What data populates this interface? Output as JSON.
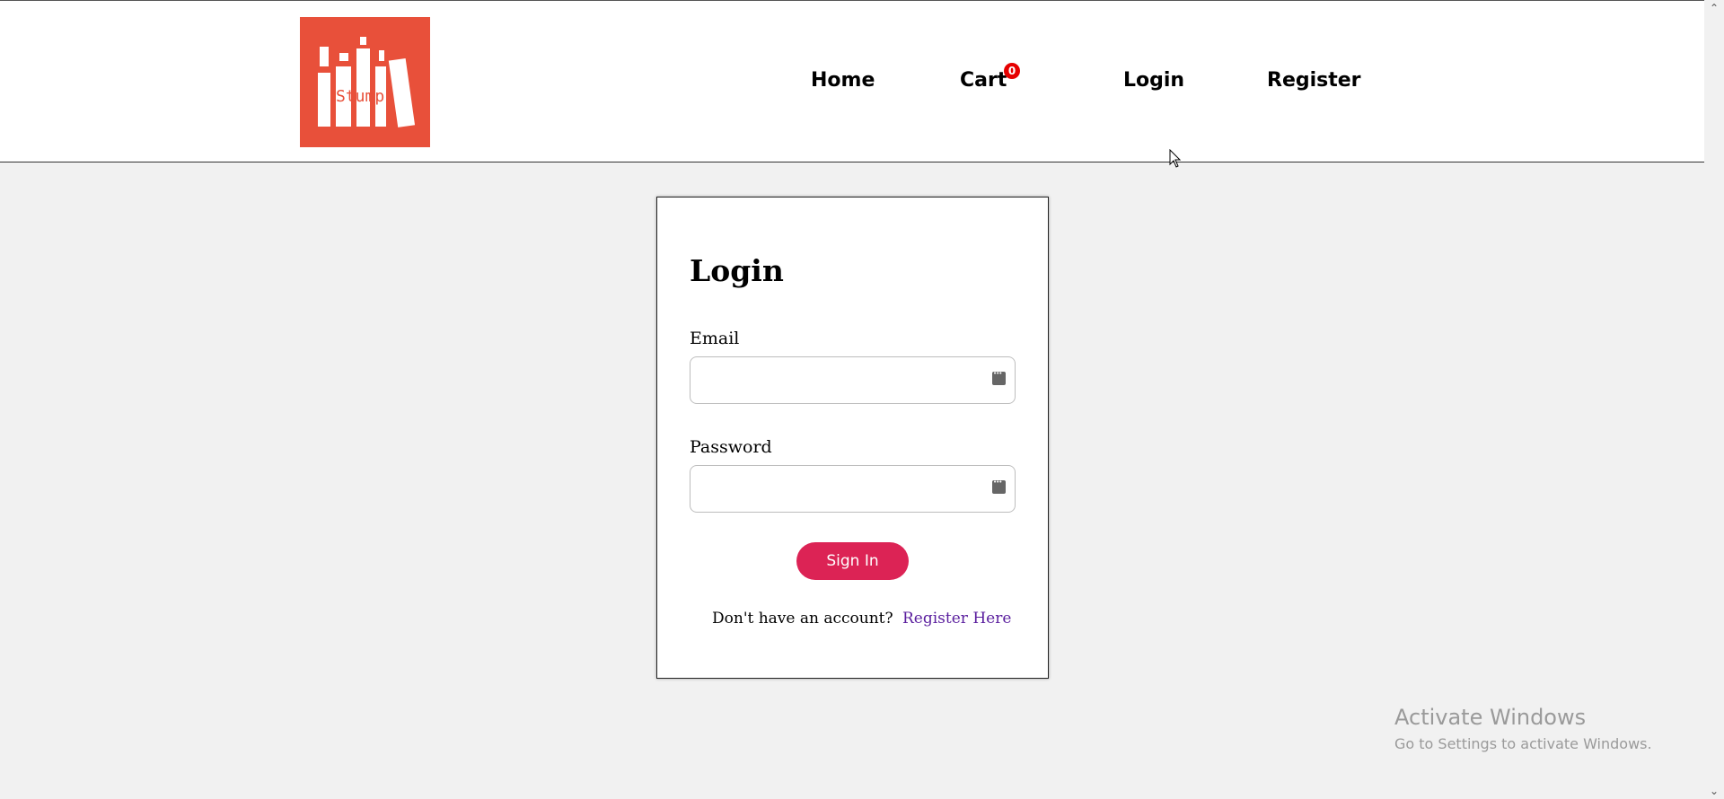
{
  "brand": {
    "logo_text": "Stumps",
    "logo_color": "#e8503a"
  },
  "nav": {
    "home": "Home",
    "cart": "Cart",
    "cart_count": "0",
    "login": "Login",
    "register": "Register"
  },
  "login_form": {
    "title": "Login",
    "email_label": "Email",
    "email_value": "",
    "password_label": "Password",
    "password_value": "",
    "submit_label": "Sign In",
    "submit_color": "#dc2355",
    "prompt": "Don't have an account?",
    "register_link": "Register Here"
  },
  "watermark": {
    "title": "Activate Windows",
    "subtitle": "Go to Settings to activate Windows."
  }
}
